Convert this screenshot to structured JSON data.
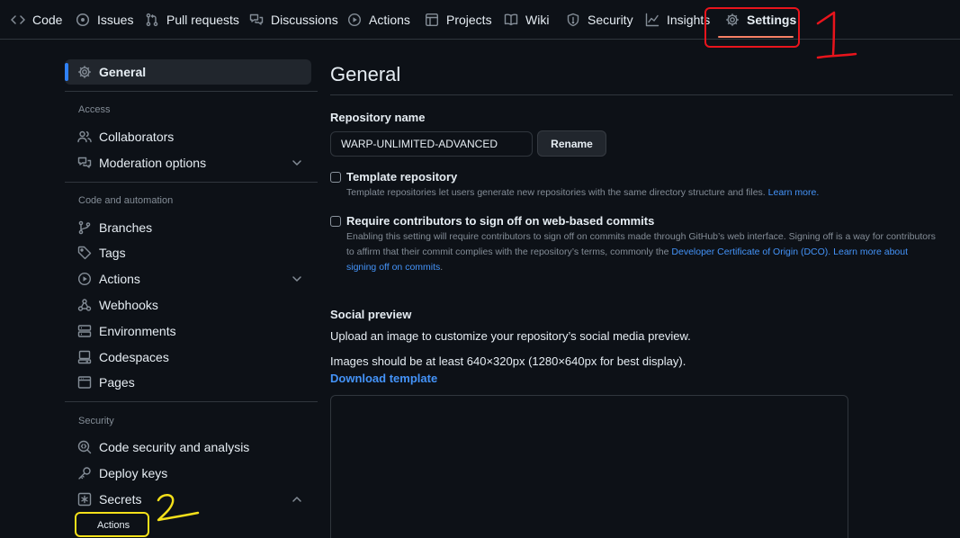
{
  "repo_nav": {
    "tabs": [
      {
        "label": "Code",
        "icon": "code-icon"
      },
      {
        "label": "Issues",
        "icon": "issue-opened-icon"
      },
      {
        "label": "Pull requests",
        "icon": "git-pull-request-icon"
      },
      {
        "label": "Discussions",
        "icon": "comment-discussion-icon"
      },
      {
        "label": "Actions",
        "icon": "play-icon"
      },
      {
        "label": "Projects",
        "icon": "table-icon"
      },
      {
        "label": "Wiki",
        "icon": "book-icon"
      },
      {
        "label": "Security",
        "icon": "shield-icon"
      },
      {
        "label": "Insights",
        "icon": "graph-icon"
      },
      {
        "label": "Settings",
        "icon": "gear-icon",
        "selected": true
      }
    ]
  },
  "annotations": {
    "red_number": "1",
    "yellow_number": "2",
    "red_color": "#e8141c",
    "yellow_color": "#f4e01a"
  },
  "sidebar": {
    "general": {
      "label": "General",
      "icon": "gear-icon"
    },
    "sections": [
      {
        "heading": "Access",
        "items": [
          {
            "label": "Collaborators",
            "icon": "people-icon"
          },
          {
            "label": "Moderation options",
            "icon": "comment-discussion-icon",
            "expandable": true
          }
        ]
      },
      {
        "heading": "Code and automation",
        "items": [
          {
            "label": "Branches",
            "icon": "git-branch-icon"
          },
          {
            "label": "Tags",
            "icon": "tag-icon"
          },
          {
            "label": "Actions",
            "icon": "play-icon",
            "expandable": true
          },
          {
            "label": "Webhooks",
            "icon": "webhook-icon"
          },
          {
            "label": "Environments",
            "icon": "server-icon"
          },
          {
            "label": "Codespaces",
            "icon": "codespaces-icon"
          },
          {
            "label": "Pages",
            "icon": "browser-icon"
          }
        ]
      },
      {
        "heading": "Security",
        "items": [
          {
            "label": "Code security and analysis",
            "icon": "codescan-icon"
          },
          {
            "label": "Deploy keys",
            "icon": "key-icon"
          },
          {
            "label": "Secrets",
            "icon": "key-asterisk-icon",
            "expanded": true
          }
        ]
      }
    ],
    "secrets_subitem": "Actions"
  },
  "main": {
    "title": "General",
    "repo_name_label": "Repository name",
    "repo_name_value": "WARP-UNLIMITED-ADVANCED",
    "rename_button": "Rename",
    "template": {
      "label": "Template repository",
      "note": "Template repositories let users generate new repositories with the same directory structure and files.",
      "link": "Learn more."
    },
    "signoff": {
      "label": "Require contributors to sign off on web-based commits",
      "note": "Enabling this setting will require contributors to sign off on commits made through GitHub’s web interface. Signing off is a way for contributors to affirm that their commit complies with the repository’s terms, commonly the",
      "link1": "Developer Certificate of Origin (DCO).",
      "link2": "Learn more about signing off on commits",
      "end": "."
    },
    "social": {
      "title": "Social preview",
      "p1": "Upload an image to customize your repository’s social media preview.",
      "p2": "Images should be at least 640×320px (1280×640px for best display).",
      "download": "Download template"
    }
  }
}
